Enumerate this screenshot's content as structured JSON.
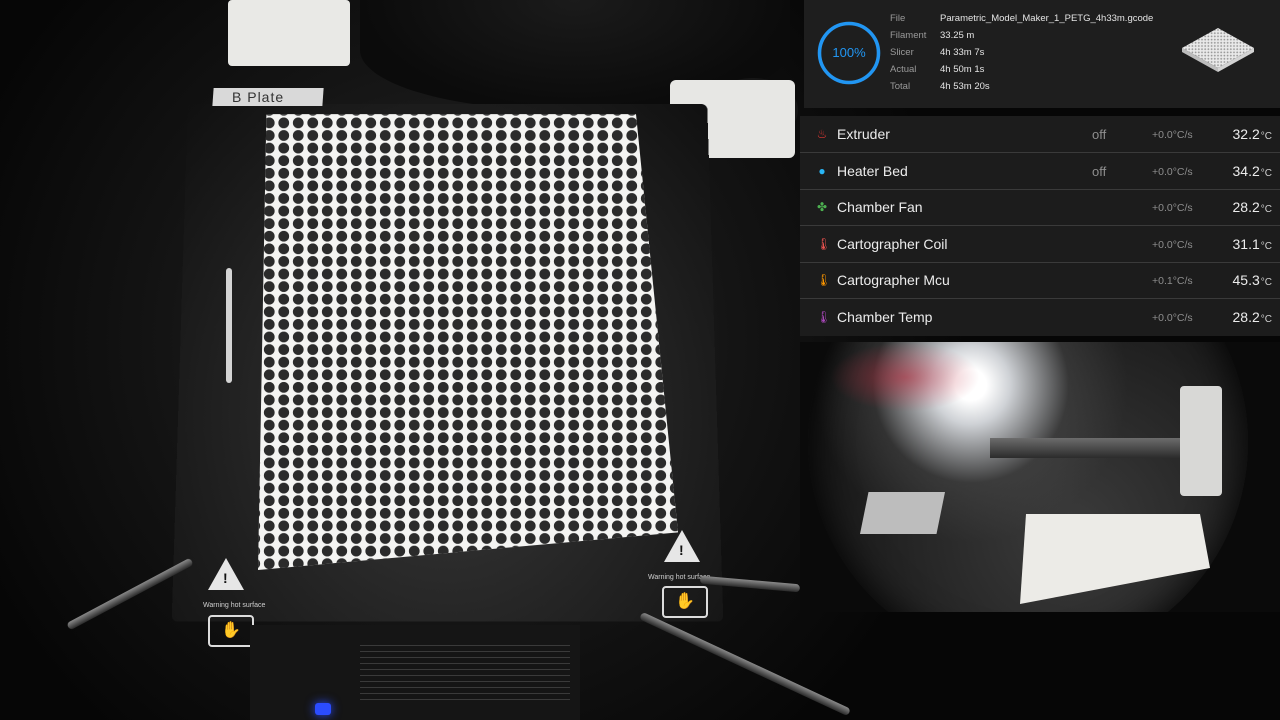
{
  "main_camera": {
    "plate_label": "B Plate",
    "warning_text": "Warning hot surface"
  },
  "status": {
    "progress_percent": 100,
    "progress_label": "100%",
    "accent_color": "#2196f3",
    "rows": [
      {
        "key": "File",
        "value": "Parametric_Model_Maker_1_PETG_4h33m.gcode"
      },
      {
        "key": "Filament",
        "value": "33.25 m"
      },
      {
        "key": "Slicer",
        "value": "4h 33m 7s"
      },
      {
        "key": "Actual",
        "value": "4h 50m 1s"
      },
      {
        "key": "Total",
        "value": "4h 53m 20s"
      }
    ],
    "thumbnail_icon": "print-thumbnail"
  },
  "sensors": [
    {
      "name": "Extruder",
      "icon": "flame-icon",
      "icon_color": "#e53935",
      "state": "off",
      "rate": "+0.0",
      "rate_unit": "°C/s",
      "temp": "32.2",
      "unit": "°C"
    },
    {
      "name": "Heater Bed",
      "icon": "radiator-icon",
      "icon_color": "#29b6f6",
      "state": "off",
      "rate": "+0.0",
      "rate_unit": "°C/s",
      "temp": "34.2",
      "unit": "°C"
    },
    {
      "name": "Chamber Fan",
      "icon": "fan-icon",
      "icon_color": "#4caf50",
      "state": "",
      "rate": "+0.0",
      "rate_unit": "°C/s",
      "temp": "28.2",
      "unit": "°C"
    },
    {
      "name": "Cartographer Coil",
      "icon": "thermometer-icon",
      "icon_color": "#ef5350",
      "state": "",
      "rate": "+0.0",
      "rate_unit": "°C/s",
      "temp": "31.1",
      "unit": "°C"
    },
    {
      "name": "Cartographer Mcu",
      "icon": "thermometer-icon",
      "icon_color": "#ff9800",
      "state": "",
      "rate": "+0.1",
      "rate_unit": "°C/s",
      "temp": "45.3",
      "unit": "°C"
    },
    {
      "name": "Chamber Temp",
      "icon": "thermometer-icon",
      "icon_color": "#ab47bc",
      "state": "",
      "rate": "+0.0",
      "rate_unit": "°C/s",
      "temp": "28.2",
      "unit": "°C"
    }
  ]
}
